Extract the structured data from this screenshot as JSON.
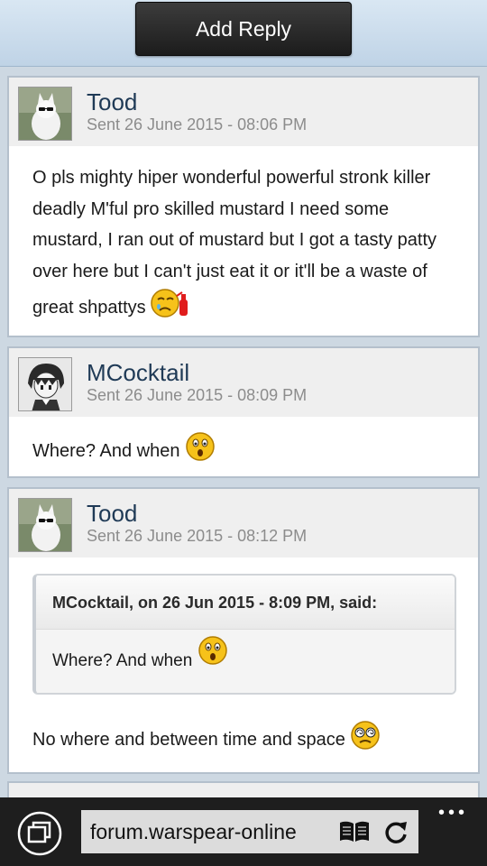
{
  "toolbar": {
    "add_reply_label": "Add Reply"
  },
  "posts": [
    {
      "author": "Tood",
      "date": "Sent 26 June 2015 - 08:06 PM",
      "body": "O pls mighty hiper wonderful powerful stronk killer deadly M'ful pro skilled mustard I need some mustard, I ran out of mustard but I got a tasty patty over here but I can't just eat it or it'll be a waste of great shpattys"
    },
    {
      "author": "MCocktail",
      "date": "Sent 26 June 2015 - 08:09 PM",
      "body": "Where? And when"
    },
    {
      "author": "Tood",
      "date": "Sent 26 June 2015 - 08:12 PM",
      "quote_header": "MCocktail, on 26 Jun 2015 - 8:09 PM, said:",
      "quote_body": "Where? And when",
      "body": "No where and between time and space"
    }
  ],
  "browser": {
    "url": "forum.warspear-online",
    "more_label": "•••"
  },
  "icons": {
    "tabs": "tabs-icon",
    "reader": "reading-view-icon",
    "refresh": "refresh-icon",
    "more": "more-options-icon"
  }
}
